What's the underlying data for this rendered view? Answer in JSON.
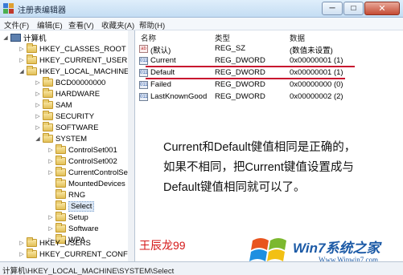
{
  "window": {
    "title": "注册表编辑器",
    "minimize": "─",
    "maximize": "□",
    "close": "✕"
  },
  "menu": [
    "文件(F)",
    "编辑(E)",
    "查看(V)",
    "收藏夹(A)",
    "帮助(H)"
  ],
  "tree": [
    {
      "label": "计算机",
      "icon": "computer-icon",
      "arrow": "◢"
    },
    {
      "label": "HKEY_CLASSES_ROOT",
      "arrow": "▷"
    },
    {
      "label": "HKEY_CURRENT_USER",
      "arrow": "▷"
    },
    {
      "label": "HKEY_LOCAL_MACHINE",
      "arrow": "◢"
    },
    {
      "label": "BCD00000000",
      "arrow": "▷"
    },
    {
      "label": "HARDWARE",
      "arrow": "▷"
    },
    {
      "label": "SAM",
      "arrow": "▷"
    },
    {
      "label": "SECURITY",
      "arrow": "▷"
    },
    {
      "label": "SOFTWARE",
      "arrow": "▷"
    },
    {
      "label": "SYSTEM",
      "arrow": "◢"
    },
    {
      "label": "ControlSet001",
      "arrow": "▷"
    },
    {
      "label": "ControlSet002",
      "arrow": "▷"
    },
    {
      "label": "CurrentControlSet",
      "arrow": "▷"
    },
    {
      "label": "MountedDevices",
      "arrow": ""
    },
    {
      "label": "RNG",
      "arrow": ""
    },
    {
      "label": "Select",
      "arrow": "",
      "selected": true
    },
    {
      "label": "Setup",
      "arrow": "▷"
    },
    {
      "label": "Software",
      "arrow": "▷"
    },
    {
      "label": "WPA",
      "arrow": "▷"
    },
    {
      "label": "HKEY_USERS",
      "arrow": "▷"
    },
    {
      "label": "HKEY_CURRENT_CONFIG",
      "arrow": "▷"
    }
  ],
  "columns": {
    "name": "名称",
    "type": "类型",
    "data": "数据"
  },
  "values": [
    {
      "name": "(默认)",
      "type": "REG_SZ",
      "data": "(数值未设置)",
      "icon": "ab"
    },
    {
      "name": "Current",
      "type": "REG_DWORD",
      "data": "0x00000001 (1)",
      "icon": "011"
    },
    {
      "name": "Default",
      "type": "REG_DWORD",
      "data": "0x00000001 (1)",
      "icon": "011"
    },
    {
      "name": "Failed",
      "type": "REG_DWORD",
      "data": "0x00000000 (0)",
      "icon": "011"
    },
    {
      "name": "LastKnownGood",
      "type": "REG_DWORD",
      "data": "0x00000002 (2)",
      "icon": "011"
    }
  ],
  "annotation": {
    "lines": [
      "Current和Default健值相同是正确的，",
      "如果不相同，把Current键值设置成与",
      "Default键值相同就可以了。"
    ],
    "signature": "王辰龙99"
  },
  "statusbar": {
    "path": "计算机\\HKEY_LOCAL_MACHINE\\SYSTEM\\Select"
  },
  "watermark": {
    "brand": "Win7系统之家",
    "url": "Www.Winwin7.com"
  },
  "colors": {
    "highlight_red": "#c8102e",
    "signature_red": "#d41818",
    "brand_blue": "#1c5aa6"
  }
}
